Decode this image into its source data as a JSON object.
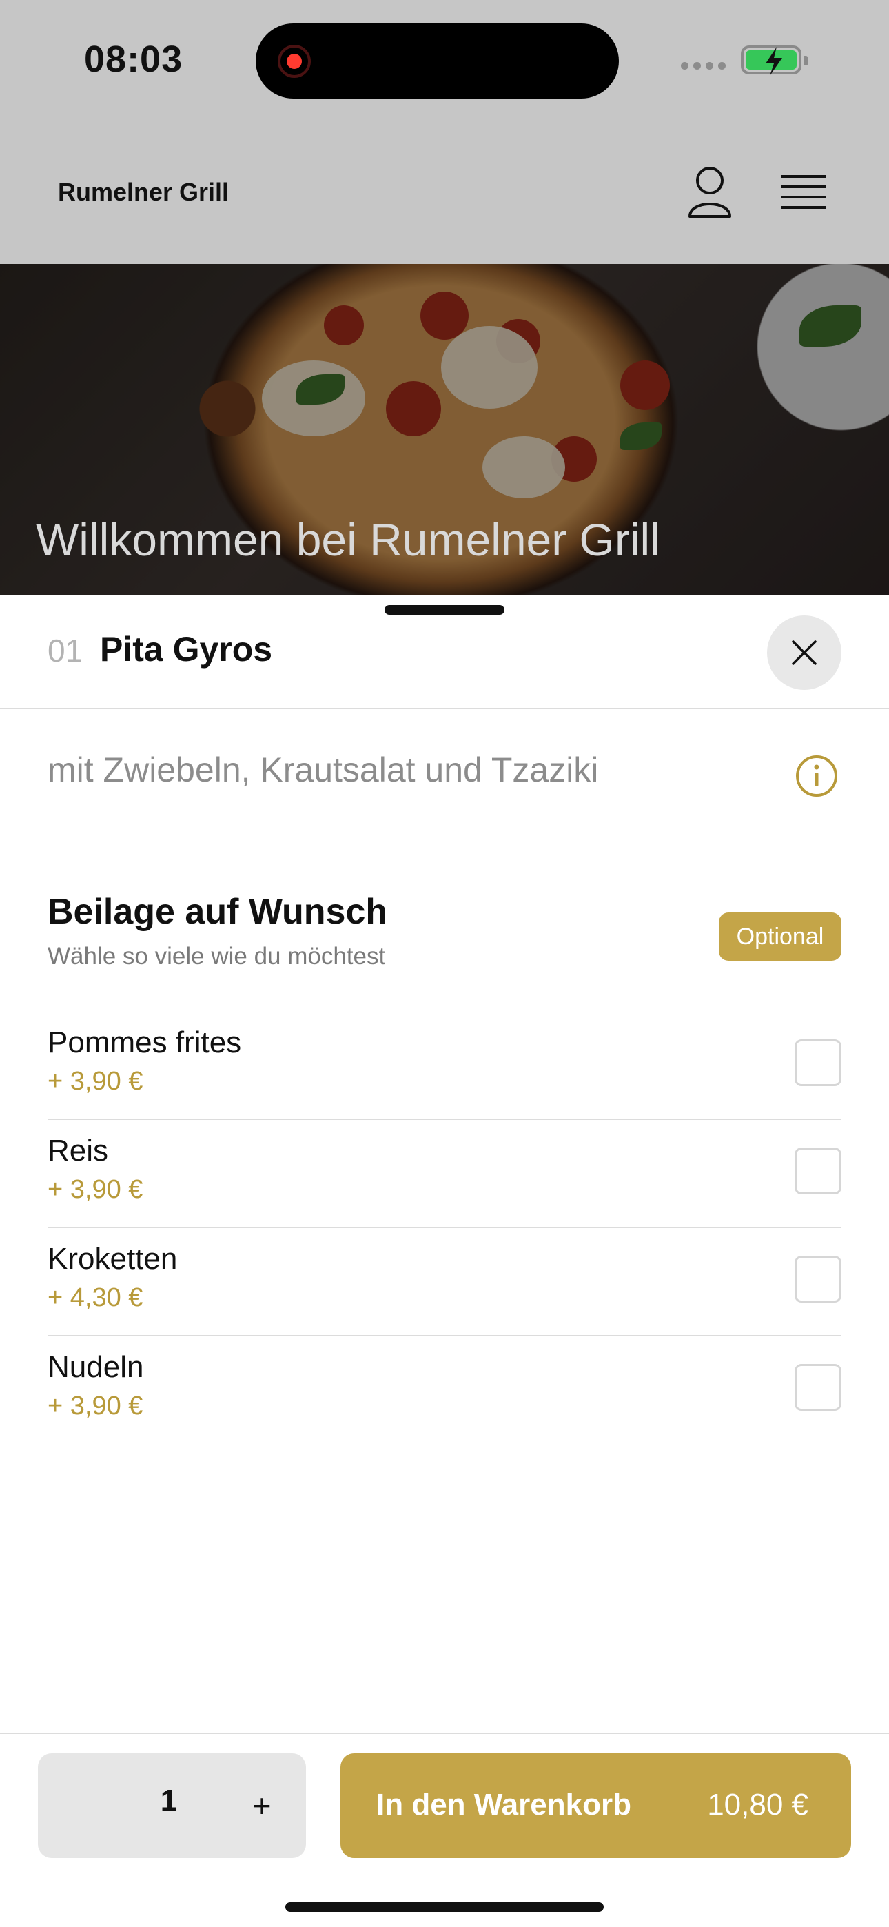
{
  "status_bar": {
    "time": "08:03"
  },
  "header": {
    "brand": "Rumelner Grill"
  },
  "hero": {
    "title": "Willkommen bei Rumelner Grill"
  },
  "item": {
    "number": "01",
    "name": "Pita Gyros",
    "description": "mit Zwiebeln, Krautsalat und Tzaziki"
  },
  "option_group": {
    "title": "Beilage auf Wunsch",
    "subtitle": "Wähle so viele wie du möchtest",
    "badge": "Optional",
    "options": [
      {
        "name": "Pommes frites",
        "price": "+ 3,90 €",
        "checked": false
      },
      {
        "name": "Reis",
        "price": "+ 3,90 €",
        "checked": false
      },
      {
        "name": "Kroketten",
        "price": "+ 4,30 €",
        "checked": false
      },
      {
        "name": "Nudeln",
        "price": "+ 3,90 €",
        "checked": false
      }
    ]
  },
  "footer": {
    "quantity": "1",
    "plus": "+",
    "cart_label": "In den Warenkorb",
    "cart_price": "10,80 €"
  },
  "colors": {
    "accent": "#c4a548",
    "price": "#b89a3a"
  },
  "icons": [
    "user-icon",
    "menu-icon",
    "close-icon",
    "info-icon",
    "battery-icon",
    "record-icon"
  ]
}
